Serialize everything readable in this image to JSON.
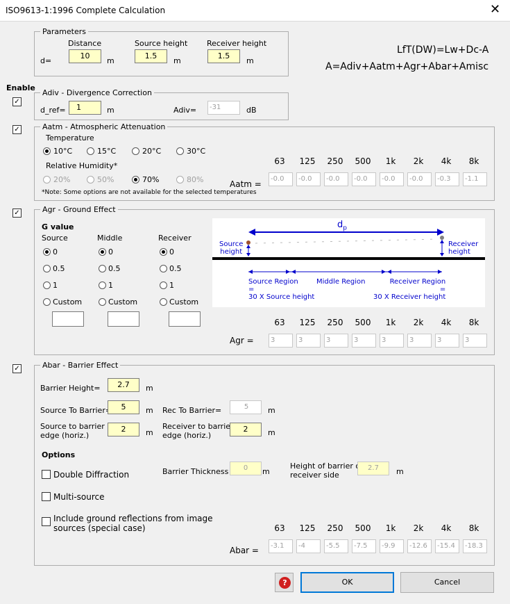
{
  "window": {
    "title": "ISO9613-1:1996 Complete Calculation",
    "close_glyph": "✕"
  },
  "formula": {
    "line1": "LfT(DW)=Lw+Dc-A",
    "line2": "A=Adiv+Aatm+Agr+Abar+Amisc"
  },
  "enable_label": "Enable",
  "check_glyph": "✓",
  "params": {
    "legend": "Parameters",
    "d_label": "d=",
    "distance_label": "Distance",
    "distance_value": "10",
    "distance_unit": "m",
    "source_height_label": "Source height",
    "source_height_value": "1.5",
    "source_height_unit": "m",
    "receiver_height_label": "Receiver height",
    "receiver_height_value": "1.5",
    "receiver_height_unit": "m"
  },
  "adiv": {
    "legend": "Adiv - Divergence Correction",
    "enabled": true,
    "dref_label": "d_ref=",
    "dref_value": "1",
    "dref_unit": "m",
    "adiv_label": "Adiv=",
    "adiv_value": "-31",
    "adiv_unit": "dB"
  },
  "aatm": {
    "legend": "Aatm - Atmospheric Attenuation",
    "enabled": true,
    "temp_label": "Temperature",
    "temps": [
      {
        "label": "10°C",
        "selected": true
      },
      {
        "label": "15°C",
        "selected": false
      },
      {
        "label": "20°C",
        "selected": false
      },
      {
        "label": "30°C",
        "selected": false
      }
    ],
    "rh_label": "Relative Humidity*",
    "rh": [
      {
        "label": "20%",
        "selected": false,
        "disabled": true
      },
      {
        "label": "50%",
        "selected": false,
        "disabled": true
      },
      {
        "label": "70%",
        "selected": true,
        "disabled": false
      },
      {
        "label": "80%",
        "selected": false,
        "disabled": true
      }
    ],
    "note": "*Note: Some options are not available for the selected temperatures",
    "row_label": "Aatm =",
    "values": [
      "-0.0",
      "-0.0",
      "-0.0",
      "-0.0",
      "-0.0",
      "-0.0",
      "-0.3",
      "-1.1"
    ]
  },
  "freqs": [
    "63",
    "125",
    "250",
    "500",
    "1k",
    "2k",
    "4k",
    "8k"
  ],
  "agr": {
    "legend": "Agr - Ground Effect",
    "enabled": true,
    "g_label": "G value",
    "columns": [
      {
        "label": "Source",
        "options": [
          "0",
          "0.5",
          "1",
          "Custom"
        ],
        "selected": 0
      },
      {
        "label": "Middle",
        "options": [
          "0",
          "0.5",
          "1",
          "Custom"
        ],
        "selected": 0
      },
      {
        "label": "Receiver",
        "options": [
          "0",
          "0.5",
          "1",
          "Custom"
        ],
        "selected": 0
      }
    ],
    "diagram": {
      "dp": "d",
      "dp_sub": "p",
      "source_height": [
        "Source",
        "height"
      ],
      "receiver_height": [
        "Receiver",
        "height"
      ],
      "source_region": [
        "Source Region",
        "=",
        "30 X Source height"
      ],
      "middle_region": "Middle Region",
      "receiver_region": [
        "Receiver Region",
        "=",
        "30 X Receiver height"
      ]
    },
    "row_label": "Agr =",
    "values": [
      "3",
      "3",
      "3",
      "3",
      "3",
      "3",
      "3",
      "3"
    ]
  },
  "abar": {
    "legend": "Abar - Barrier Effect",
    "enabled": true,
    "barrier_height_label": "Barrier Height=",
    "barrier_height_value": "2.7",
    "source_to_barrier_label": "Source To Barrier=",
    "source_to_barrier_value": "5",
    "rec_to_barrier_label": "Rec To Barrier=",
    "rec_to_barrier_value": "5",
    "src_edge_label": [
      "Source to barrier",
      "edge (horiz.)"
    ],
    "src_edge_value": "2",
    "rec_edge_label": [
      "Receiver to barrier",
      "edge (horiz.)"
    ],
    "rec_edge_value": "2",
    "unit": "m",
    "options_label": "Options",
    "double_diffraction": "Double Diffraction",
    "multi_source": "Multi-source",
    "ground_reflections": [
      "Include ground reflections from image",
      "sources (special case)"
    ],
    "thickness_label": "Barrier Thickness =",
    "thickness_value": "0",
    "height_rec_label": [
      "Height of barrier on",
      "receiver side"
    ],
    "height_rec_value": "2.7",
    "row_label": "Abar =",
    "values": [
      "-3.1",
      "-4",
      "-5.5",
      "-7.5",
      "-9.9",
      "-12.6",
      "-15.4",
      "-18.3"
    ]
  },
  "buttons": {
    "help": "?",
    "ok": "OK",
    "cancel": "Cancel"
  }
}
